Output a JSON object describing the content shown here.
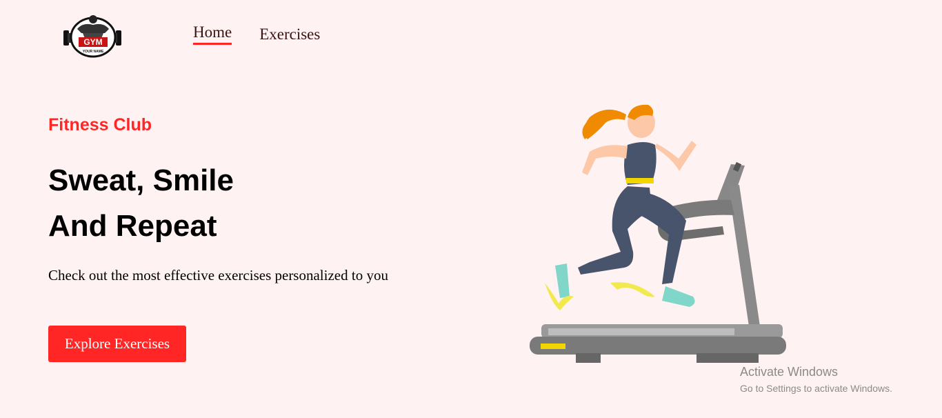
{
  "logo": {
    "text": "GYM",
    "subtext": "YOUR NAME",
    "icon": "bodybuilder-dumbbell-logo"
  },
  "nav": {
    "items": [
      {
        "label": "Home",
        "active": true
      },
      {
        "label": "Exercises",
        "active": false
      }
    ]
  },
  "hero": {
    "kicker": "Fitness Club",
    "title_line1": "Sweat, Smile",
    "title_line2": "And Repeat",
    "description": "Check out the most effective exercises personalized to you",
    "cta_label": "Explore Exercises"
  },
  "banner": {
    "icon": "woman-running-on-treadmill-illustration"
  },
  "watermark": {
    "title": "Activate Windows",
    "subtitle": "Go to Settings to activate Windows."
  },
  "colors": {
    "accent": "#ff2625",
    "background": "#fff2f2",
    "nav_text": "#3a1212"
  }
}
